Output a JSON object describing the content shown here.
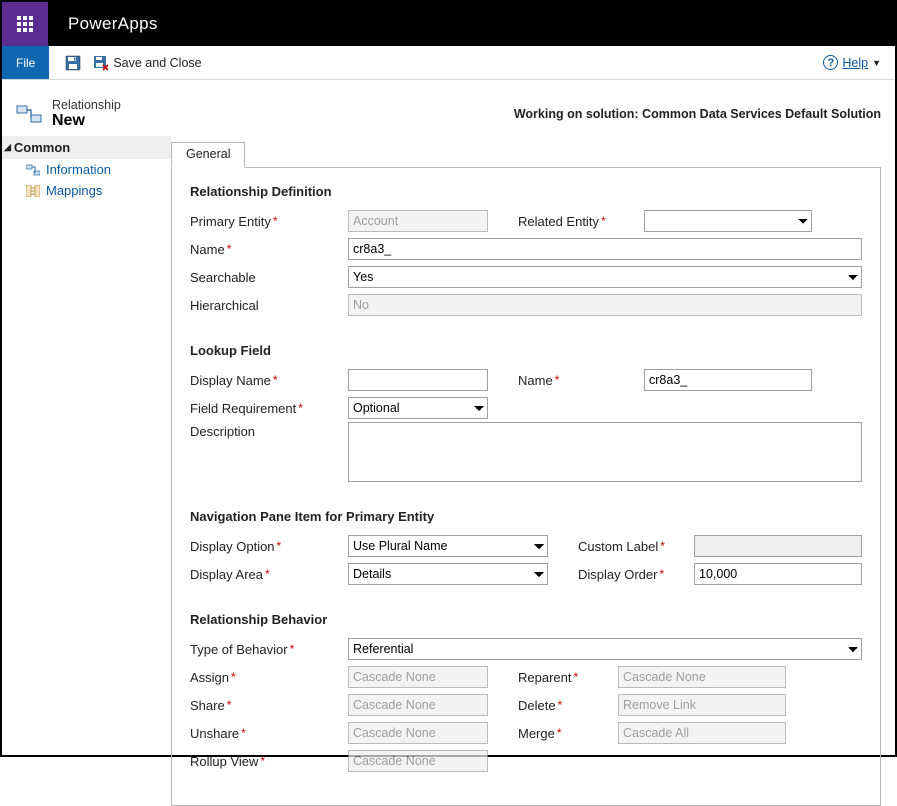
{
  "brand": "PowerApps",
  "ribbon": {
    "file": "File",
    "save_close": "Save and Close",
    "help": "Help"
  },
  "header": {
    "kicker": "Relationship",
    "title": "New",
    "solution": "Working on solution: Common Data Services Default Solution"
  },
  "sidebar": {
    "group": "Common",
    "items": [
      "Information",
      "Mappings"
    ]
  },
  "tab": "General",
  "groups": {
    "definition": "Relationship Definition",
    "lookup": "Lookup Field",
    "navpane": "Navigation Pane Item for Primary Entity",
    "behavior": "Relationship Behavior"
  },
  "definition": {
    "primary_entity_label": "Primary Entity",
    "primary_entity_value": "Account",
    "related_entity_label": "Related Entity",
    "related_entity_value": "",
    "name_label": "Name",
    "name_value": "cr8a3_",
    "searchable_label": "Searchable",
    "searchable_value": "Yes",
    "hierarchical_label": "Hierarchical",
    "hierarchical_value": "No"
  },
  "lookup": {
    "display_name_label": "Display Name",
    "display_name_value": "",
    "name_label": "Name",
    "name_value": "cr8a3_",
    "field_req_label": "Field Requirement",
    "field_req_value": "Optional",
    "description_label": "Description",
    "description_value": ""
  },
  "navpane": {
    "display_option_label": "Display Option",
    "display_option_value": "Use Plural Name",
    "custom_label_label": "Custom Label",
    "custom_label_value": "",
    "display_area_label": "Display Area",
    "display_area_value": "Details",
    "display_order_label": "Display Order",
    "display_order_value": "10,000"
  },
  "behavior": {
    "type_label": "Type of Behavior",
    "type_value": "Referential",
    "assign_label": "Assign",
    "assign_value": "Cascade None",
    "reparent_label": "Reparent",
    "reparent_value": "Cascade None",
    "share_label": "Share",
    "share_value": "Cascade None",
    "delete_label": "Delete",
    "delete_value": "Remove Link",
    "unshare_label": "Unshare",
    "unshare_value": "Cascade None",
    "merge_label": "Merge",
    "merge_value": "Cascade All",
    "rollup_label": "Rollup View",
    "rollup_value": "Cascade None"
  }
}
